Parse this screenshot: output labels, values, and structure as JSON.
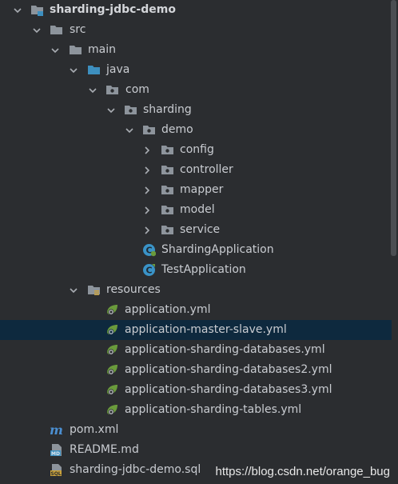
{
  "tree": {
    "root": "sharding-jdbc-demo",
    "src": "src",
    "main": "main",
    "java": "java",
    "com": "com",
    "sharding": "sharding",
    "demo": "demo",
    "packages": [
      "config",
      "controller",
      "mapper",
      "model",
      "service"
    ],
    "classes": [
      "ShardingApplication",
      "TestApplication"
    ],
    "resources": "resources",
    "yml_files": [
      "application.yml",
      "application-master-slave.yml",
      "application-sharding-databases.yml",
      "application-sharding-databases2.yml",
      "application-sharding-databases3.yml",
      "application-sharding-tables.yml"
    ],
    "root_files": [
      "pom.xml",
      "README.md",
      "sharding-jdbc-demo.sql"
    ],
    "selected": "application-master-slave.yml"
  },
  "watermark": "https://blog.csdn.net/orange_bug",
  "colors": {
    "background": "#2b2d30",
    "selection": "#0e293e",
    "folder": "#8d949c",
    "source_folder": "#3d8fbf",
    "spring_leaf": "#6a9a3c",
    "class_icon": "#3a93c7",
    "maven": "#4b8fd1"
  }
}
